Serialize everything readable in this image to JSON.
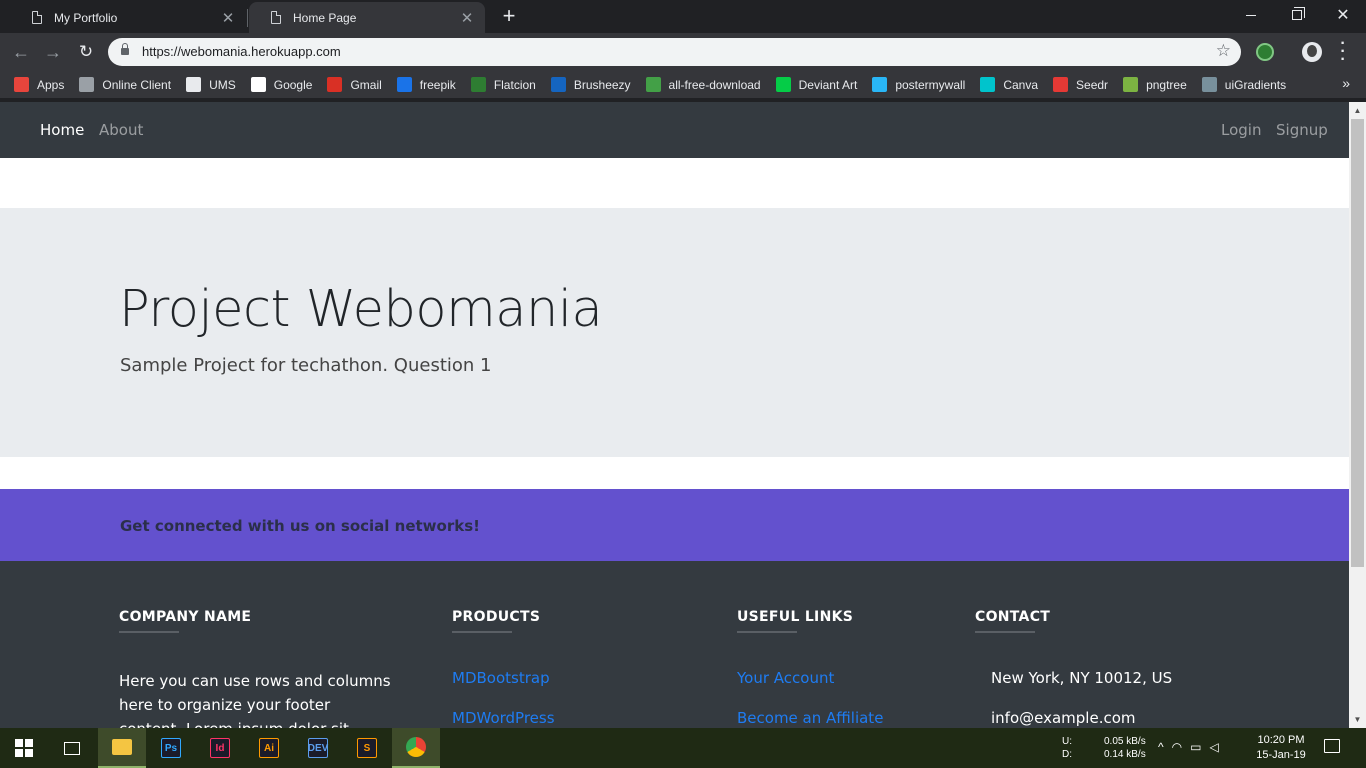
{
  "browser": {
    "tabs": [
      {
        "title": "My Portfolio",
        "active": false
      },
      {
        "title": "Home Page",
        "active": true
      }
    ],
    "url": "https://webomania.herokuapp.com",
    "bookmarks": [
      {
        "label": "Apps",
        "icon": "apps-grid-icon",
        "color": "#e8453c"
      },
      {
        "label": "Online Client",
        "icon": "cloud-icon",
        "color": "#9aa0a6"
      },
      {
        "label": "UMS",
        "icon": "document-icon",
        "color": "#e8eaed"
      },
      {
        "label": "Google",
        "icon": "google-icon",
        "color": "#ffffff"
      },
      {
        "label": "Gmail",
        "icon": "gmail-icon",
        "color": "#d93025"
      },
      {
        "label": "freepik",
        "icon": "freepik-icon",
        "color": "#1a73e8"
      },
      {
        "label": "Flatcion",
        "icon": "flaticon-icon",
        "color": "#2e7d32"
      },
      {
        "label": "Brusheezy",
        "icon": "brusheezy-icon",
        "color": "#1565c0"
      },
      {
        "label": "all-free-download",
        "icon": "download-arrow-icon",
        "color": "#43a047"
      },
      {
        "label": "Deviant Art",
        "icon": "deviantart-icon",
        "color": "#05cc47"
      },
      {
        "label": "postermywall",
        "icon": "postermywall-icon",
        "color": "#29b6f6"
      },
      {
        "label": "Canva",
        "icon": "canva-icon",
        "color": "#00c4cc"
      },
      {
        "label": "Seedr",
        "icon": "seedr-icon",
        "color": "#e53935"
      },
      {
        "label": "pngtree",
        "icon": "pngtree-icon",
        "color": "#7cb342"
      },
      {
        "label": "uiGradients",
        "icon": "uigradients-icon",
        "color": "#78909c"
      }
    ]
  },
  "site": {
    "nav": {
      "home": "Home",
      "about": "About",
      "login": "Login",
      "signup": "Signup"
    },
    "hero": {
      "title": "Project Webomania",
      "subtitle": "Sample Project for techathon. Question 1"
    },
    "social": {
      "text": "Get connected with us on social networks!"
    },
    "footer": {
      "company": {
        "heading": "COMPANY NAME",
        "text": "Here you can use rows and columns here to organize your footer content. Lorem ipsum dolor sit"
      },
      "products": {
        "heading": "PRODUCTS",
        "links": [
          "MDBootstrap",
          "MDWordPress"
        ]
      },
      "useful": {
        "heading": "USEFUL LINKS",
        "links": [
          "Your Account",
          "Become an Affiliate"
        ]
      },
      "contact": {
        "heading": "CONTACT",
        "lines": [
          "New York, NY 10012, US",
          "info@example.com"
        ]
      }
    }
  },
  "taskbar": {
    "net_labels": [
      "U:",
      "D:"
    ],
    "net_rates": [
      "0.05 kB/s",
      "0.14 kB/s"
    ],
    "time": "10:20 PM",
    "date": "15-Jan-19",
    "apps": [
      {
        "name": "file-explorer-icon",
        "label": "",
        "color": "#f4c542"
      },
      {
        "name": "photoshop-icon",
        "label": "Ps",
        "color": "#31a8ff"
      },
      {
        "name": "indesign-icon",
        "label": "Id",
        "color": "#ff3366"
      },
      {
        "name": "illustrator-icon",
        "label": "Ai",
        "color": "#ff9a00"
      },
      {
        "name": "devc-icon",
        "label": "DEV",
        "color": "#5c9ded"
      },
      {
        "name": "sublime-icon",
        "label": "S",
        "color": "#ff9800"
      },
      {
        "name": "chrome-icon",
        "label": "",
        "color": "#4caf50"
      }
    ]
  }
}
